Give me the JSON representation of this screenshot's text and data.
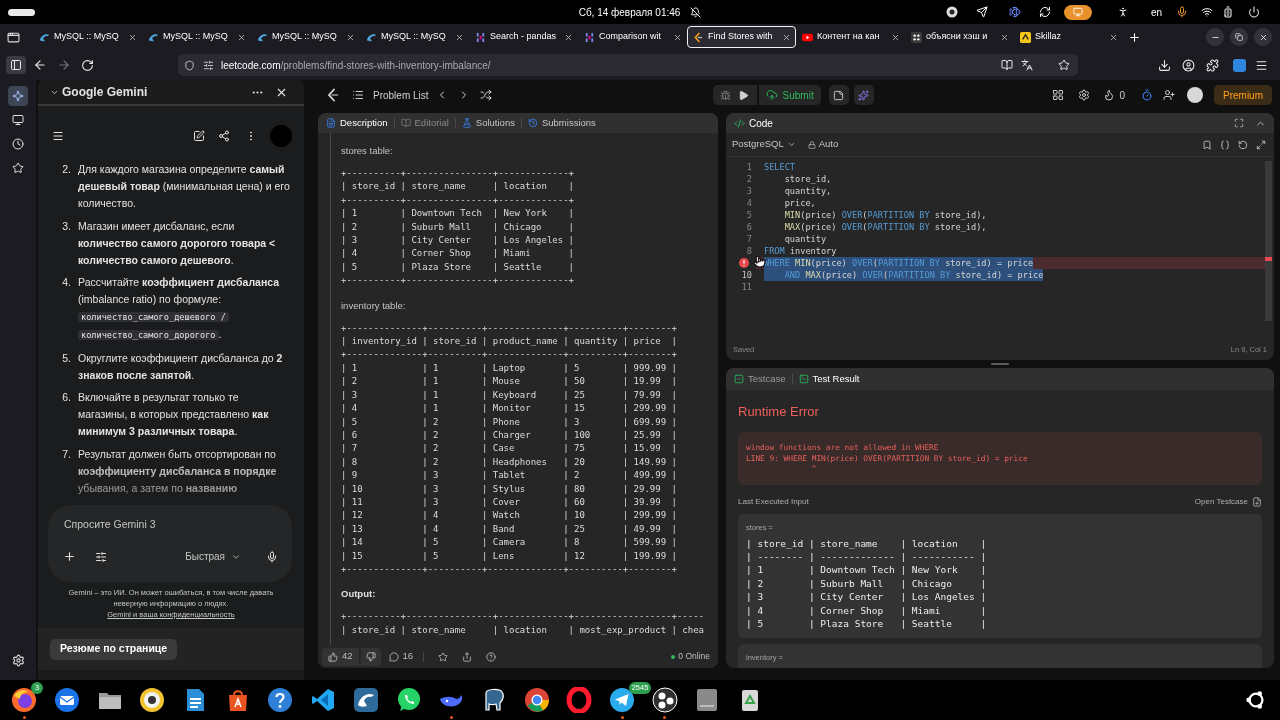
{
  "system_bar": {
    "datetime": "Сб, 14 февраля 01:46",
    "keyboard_layout": "en"
  },
  "browser_tabs": [
    {
      "title": "MySQL :: MySQ",
      "kind": "dolphin",
      "selected": false
    },
    {
      "title": "MySQL :: MySQ",
      "kind": "dolphin",
      "selected": false
    },
    {
      "title": "MySQL :: MySQ",
      "kind": "dolphin",
      "selected": false
    },
    {
      "title": "MySQL :: MySQ",
      "kind": "dolphin",
      "selected": false
    },
    {
      "title": "Search - pandas",
      "kind": "bars",
      "selected": false
    },
    {
      "title": "Comparison wit",
      "kind": "bars",
      "selected": false
    },
    {
      "title": "Find Stores with",
      "kind": "bracket",
      "selected": true
    },
    {
      "title": "Контент на кан",
      "kind": "video",
      "selected": false
    },
    {
      "title": "объясни хэш и",
      "kind": "grid",
      "selected": false
    },
    {
      "title": "Skillaz",
      "kind": "tile",
      "selected": false
    }
  ],
  "address_bar": {
    "domain": "leetcode.com",
    "path": "/problems/find-stores-with-inventory-imbalance/"
  },
  "side_rail": [
    {
      "kind": "sparkle",
      "selected": true
    },
    {
      "kind": "monitor",
      "selected": false
    },
    {
      "kind": "clock",
      "selected": false
    },
    {
      "kind": "star",
      "selected": false
    }
  ],
  "gemini": {
    "title": "Google Gemini",
    "list": [
      {
        "number": "2.",
        "text": "Для каждого магазина определите **самый дешевый товар** (минимальная цена) и его количество."
      },
      {
        "number": "3.",
        "text": "Магазин имеет дисбаланс, если **количество самого дорогого товара < количество самого дешевого**."
      },
      {
        "number": "4.",
        "text": "Рассчитайте **коэффициент дисбаланса** (imbalance ratio) по формуле:",
        "code": "количество_самого_дешевого / количество_самого_дорогого",
        "after_code": "."
      },
      {
        "number": "5.",
        "text": "Округлите коэффициент дисбаланса до **2 знаков после запятой**."
      },
      {
        "number": "6.",
        "text": "Включайте в результат только те магазины, в которых представлено **как минимум 3 различных товара**."
      },
      {
        "number": "7.",
        "text": "Результат должен быть отсортирован по **коэффициенту дисбаланса в порядке** убывания, а затем по **названию**"
      }
    ],
    "input": {
      "placeholder": "Спросите Gemini 3"
    },
    "mode": "Быстрая",
    "disclaimer": "Gemini – это ИИ. Он может ошибаться, в том числе давать неверную информацию о людях.",
    "privacy_link": "Gemini и ваша конфиденциальность",
    "summary_button": "Резюме по странице"
  },
  "leetcode": {
    "nav": {
      "problem_list": "Problem List",
      "submit": "Submit",
      "streak": "0",
      "premium": "Premium"
    },
    "description": {
      "tabs": [
        {
          "label": "Description",
          "kind": "doc",
          "selected": true,
          "disabled": false
        },
        {
          "label": "Editorial",
          "kind": "book",
          "selected": false,
          "disabled": true
        },
        {
          "label": "Solutions",
          "kind": "flask",
          "selected": false,
          "disabled": false
        },
        {
          "label": "Submissions",
          "kind": "history",
          "selected": false,
          "disabled": false
        }
      ],
      "blocks": [
        {
          "kind": "label",
          "text": "stores table:"
        },
        {
          "kind": "table",
          "lines": [
            "+----------+----------------+-------------+",
            "| store_id | store_name     | location    |",
            "+----------+----------------+-------------+",
            "| 1        | Downtown Tech  | New York    |",
            "| 2        | Suburb Mall    | Chicago     |",
            "| 3        | City Center    | Los Angeles |",
            "| 4        | Corner Shop    | Miami       |",
            "| 5        | Plaza Store    | Seattle     |",
            "+----------+----------------+-------------+"
          ]
        },
        {
          "kind": "label",
          "text": "inventory table:"
        },
        {
          "kind": "table",
          "lines": [
            "+--------------+----------+--------------+----------+--------+",
            "| inventory_id | store_id | product_name | quantity | price  |",
            "+--------------+----------+--------------+----------+--------+",
            "| 1            | 1        | Laptop       | 5        | 999.99 |",
            "| 2            | 1        | Mouse        | 50       | 19.99  |",
            "| 3            | 1        | Keyboard     | 25       | 79.99  |",
            "| 4            | 1        | Monitor      | 15       | 299.99 |",
            "| 5            | 2        | Phone        | 3        | 699.99 |",
            "| 6            | 2        | Charger      | 100      | 25.99  |",
            "| 7            | 2        | Case         | 75       | 15.99  |",
            "| 8            | 2        | Headphones   | 20       | 149.99 |",
            "| 9            | 3        | Tablet       | 2        | 499.99 |",
            "| 10           | 3        | Stylus       | 80       | 29.99  |",
            "| 11           | 3        | Cover        | 60       | 39.99  |",
            "| 12           | 4        | Watch        | 10       | 299.99 |",
            "| 13           | 4        | Band         | 25       | 49.99  |",
            "| 14           | 5        | Camera       | 8        | 599.99 |",
            "| 15           | 5        | Lens         | 12       | 199.99 |",
            "+--------------+----------+--------------+----------+--------+"
          ]
        },
        {
          "kind": "heading",
          "text": "Output:"
        },
        {
          "kind": "table",
          "lines": [
            "+----------+----------------+-------------+------------------+-----",
            "| store_id | store_name     | location    | most_exp_product | chea"
          ]
        }
      ],
      "likes": "42",
      "comments": "16",
      "online": "0 Online"
    },
    "editor": {
      "title": "Code",
      "language": "PostgreSQL",
      "mode": "Auto",
      "lines": [
        {
          "number": "1",
          "selected": false,
          "error": false,
          "tokens": [
            {
              "kind": "keyword",
              "text": "SELECT"
            }
          ]
        },
        {
          "number": "2",
          "selected": false,
          "error": false,
          "tokens": [
            {
              "kind": "plain",
              "text": "    store_id,"
            }
          ]
        },
        {
          "number": "3",
          "selected": false,
          "error": false,
          "tokens": [
            {
              "kind": "plain",
              "text": "    quantity,"
            }
          ]
        },
        {
          "number": "4",
          "selected": false,
          "error": false,
          "tokens": [
            {
              "kind": "plain",
              "text": "    price,"
            }
          ]
        },
        {
          "number": "5",
          "selected": false,
          "error": false,
          "tokens": [
            {
              "kind": "function",
              "text": "    MIN"
            },
            {
              "kind": "plain",
              "text": "(price) "
            },
            {
              "kind": "keyword",
              "text": "OVER"
            },
            {
              "kind": "plain",
              "text": "("
            },
            {
              "kind": "keyword",
              "text": "PARTITION BY"
            },
            {
              "kind": "plain",
              "text": " store_id),"
            }
          ]
        },
        {
          "number": "6",
          "selected": false,
          "error": false,
          "tokens": [
            {
              "kind": "function",
              "text": "    MAX"
            },
            {
              "kind": "plain",
              "text": "(price) "
            },
            {
              "kind": "keyword",
              "text": "OVER"
            },
            {
              "kind": "plain",
              "text": "("
            },
            {
              "kind": "keyword",
              "text": "PARTITION BY"
            },
            {
              "kind": "plain",
              "text": " store_id),"
            }
          ]
        },
        {
          "number": "7",
          "selected": false,
          "error": false,
          "tokens": [
            {
              "kind": "plain",
              "text": "    quantity"
            }
          ]
        },
        {
          "number": "8",
          "selected": false,
          "error": false,
          "tokens": [
            {
              "kind": "keyword",
              "text": "FROM"
            },
            {
              "kind": "plain",
              "text": " inventory"
            }
          ]
        },
        {
          "selected": true,
          "error": true,
          "tokens": [
            {
              "kind": "keyword",
              "text": "WHERE "
            },
            {
              "kind": "function",
              "text": "MIN"
            },
            {
              "kind": "plain",
              "text": "(price) "
            },
            {
              "kind": "keyword",
              "text": "OVER"
            },
            {
              "kind": "plain",
              "text": "("
            },
            {
              "kind": "keyword",
              "text": "PARTITION BY"
            },
            {
              "kind": "plain",
              "text": " store_id) = price"
            }
          ]
        },
        {
          "number": "10",
          "selected": true,
          "error": false,
          "tokens": [
            {
              "kind": "keyword",
              "text": "    AND "
            },
            {
              "kind": "function",
              "text": "MAX"
            },
            {
              "kind": "plain",
              "text": "(price) "
            },
            {
              "kind": "keyword",
              "text": "OVER"
            },
            {
              "kind": "plain",
              "text": "("
            },
            {
              "kind": "keyword",
              "text": "PARTITION BY"
            },
            {
              "kind": "plain",
              "text": " store_id) = price"
            }
          ]
        },
        {
          "number": "11",
          "selected": false,
          "error": false
        }
      ],
      "saved": "Saved",
      "cursor": "Ln 9, Col 1"
    },
    "result": {
      "tabs": [
        {
          "label": "Testcase",
          "kind": "check",
          "selected": false
        },
        {
          "label": "Test Result",
          "kind": "terminal",
          "selected": true
        }
      ],
      "status": "Runtime Error",
      "error_lines": [
        "window functions are not allowed in WHERE",
        "LINE 9: WHERE MIN(price) OVER(PARTITION BY store_id) = price",
        "              ^"
      ],
      "last_input": "Last Executed Input",
      "open_testcase": "Open Testcase",
      "inputs": [
        {
          "name": "stores =",
          "lines": [
            "| store_id | store_name    | location    |",
            "| -------- | ------------- | ----------- |",
            "| 1        | Downtown Tech | New York    |",
            "| 2        | Suburb Mall   | Chicago     |",
            "| 3        | City Center   | Los Angeles |",
            "| 4        | Corner Shop   | Miami       |",
            "| 5        | Plaza Store   | Seattle     |"
          ]
        },
        {
          "name": "inventory ="
        }
      ]
    }
  },
  "dock": [
    {
      "kind": "fox-browser",
      "badge": "3",
      "running": true
    },
    {
      "kind": "mail",
      "running": false
    },
    {
      "kind": "files",
      "running": false
    },
    {
      "kind": "speaker",
      "running": false
    },
    {
      "kind": "document",
      "running": false
    },
    {
      "kind": "store",
      "running": false
    },
    {
      "kind": "help",
      "running": false
    },
    {
      "kind": "code-editor",
      "running": false
    },
    {
      "kind": "dolphin",
      "running": false
    },
    {
      "kind": "chat",
      "running": false
    },
    {
      "kind": "whale",
      "running": true
    },
    {
      "kind": "elephant",
      "running": false
    },
    {
      "kind": "browser",
      "running": false
    },
    {
      "kind": "ring",
      "running": false
    },
    {
      "kind": "plane",
      "badge": "2545",
      "running": true
    },
    {
      "kind": "recorder",
      "running": true
    },
    {
      "kind": "drive",
      "running": false
    },
    {
      "kind": "recycle",
      "running": false
    }
  ]
}
